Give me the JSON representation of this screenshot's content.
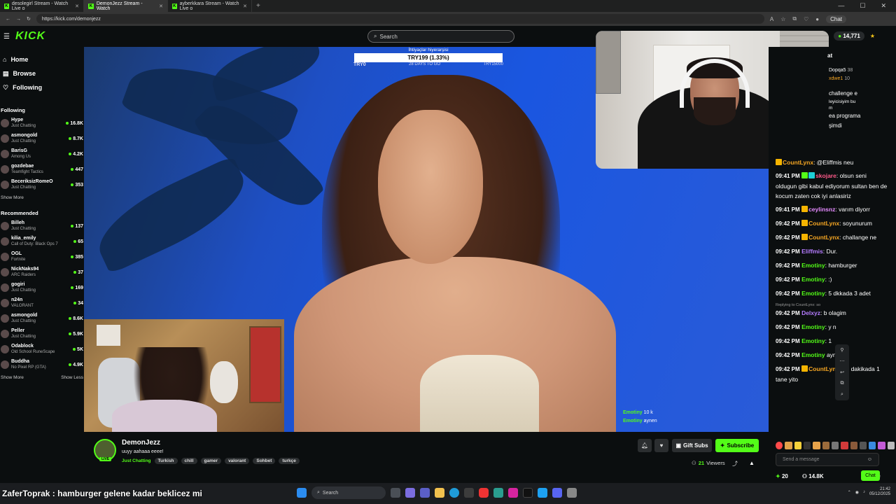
{
  "browser": {
    "tabs": [
      {
        "title": "desolegirl Stream - Watch Live o",
        "active": false
      },
      {
        "title": "DemonJezz Stream - Watch",
        "active": true
      },
      {
        "title": "ayberkkara Stream - Watch Live o",
        "active": false
      }
    ],
    "url": "https://kick.com/demonjezz",
    "chat_button": "Chat"
  },
  "header": {
    "logo": "KICK",
    "search_placeholder": "Search",
    "balance": "14,771"
  },
  "sidebar": {
    "nav": [
      {
        "label": "Home",
        "icon": "home-icon"
      },
      {
        "label": "Browse",
        "icon": "browse-icon"
      },
      {
        "label": "Following",
        "icon": "heart-icon"
      }
    ],
    "following_title": "Following",
    "following": [
      {
        "name": "Hype",
        "game": "Just Chatting",
        "viewers": "16.8K"
      },
      {
        "name": "asmongold",
        "game": "Just Chatting",
        "viewers": "8.7K"
      },
      {
        "name": "BarisG",
        "game": "Among Us",
        "viewers": "4.2K"
      },
      {
        "name": "gozdebae",
        "game": "Teamfight Tactics",
        "viewers": "447"
      },
      {
        "name": "BeceriksizRomeO",
        "game": "Just Chatting",
        "viewers": "353"
      }
    ],
    "show_more_1": "Show More",
    "recommended_title": "Recommended",
    "recommended": [
      {
        "name": "Billeh",
        "game": "Just Chatting",
        "viewers": "137"
      },
      {
        "name": "kilia_emily",
        "game": "Call of Duty: Black Ops 7",
        "viewers": "65"
      },
      {
        "name": "OGL",
        "game": "Fortnite",
        "viewers": "385"
      },
      {
        "name": "NickNaks94",
        "game": "ARC Raiders",
        "viewers": "37"
      },
      {
        "name": "gogiri",
        "game": "Just Chatting",
        "viewers": "169"
      },
      {
        "name": "n24n",
        "game": "VALORANT",
        "viewers": "34"
      },
      {
        "name": "asmongold",
        "game": "Just Chatting",
        "viewers": "8.6K"
      },
      {
        "name": "Peller",
        "game": "Just Chatting",
        "viewers": "5.9K"
      },
      {
        "name": "Odablock",
        "game": "Old School RuneScape",
        "viewers": "5K"
      },
      {
        "name": "Buddha",
        "game": "No Pixel RP (GTA)",
        "viewers": "4.9K"
      }
    ],
    "show_more_2": "Show More",
    "show_less": "Show Less"
  },
  "goal": {
    "title": "İhtiyaçlar hiyerarşisi",
    "progress_text": "TRY199 (1.33%)",
    "progress": 0.0133,
    "start": "TRY0",
    "days": "28 DAYS TO GO",
    "target": "TRY15000"
  },
  "overlay_chat": [
    {
      "user": "Emotiny",
      "text": "10 k"
    },
    {
      "user": "Emotiny",
      "text": "aynen"
    }
  ],
  "chat": {
    "top_users": [
      {
        "name": "Dopqa5",
        "count": "38"
      },
      {
        "name": "xdwe1",
        "count": "10"
      }
    ],
    "partial_lines": [
      "challenge e",
      "leyicisiyim bu",
      "m",
      "ea programa",
      "şimdi"
    ],
    "header_cut": "at",
    "messages": [
      {
        "time": "",
        "user": "CountLynx",
        "badge": "crown",
        "color": "#f5a623",
        "text": ": @Eliffmis neu"
      },
      {
        "time": "09:41 PM",
        "user": "skojare",
        "badge": "green",
        "color": "#ff5a8a",
        "text": ": olsun seni oldugun gibi kabul ediyorum sultan ben de kocum zaten cok iyi anlasiriz"
      },
      {
        "time": "09:41 PM",
        "user": "ceylinsnz",
        "badge": "crown",
        "color": "#e58bff",
        "text": ": varım diyorr"
      },
      {
        "time": "09:42 PM",
        "user": "CountLynx",
        "badge": "crown",
        "color": "#f5a623",
        "text": ": soyunurum"
      },
      {
        "time": "09:42 PM",
        "user": "CountLynx",
        "badge": "crown",
        "color": "#f5a623",
        "text": ": challange ne"
      },
      {
        "time": "09:42 PM",
        "user": "Eliffmis",
        "badge": "",
        "color": "#b57cff",
        "text": ": Dur."
      },
      {
        "time": "09:42 PM",
        "user": "Emotiny",
        "badge": "",
        "color": "#53fc18",
        "text": ": hamburger"
      },
      {
        "time": "09:42 PM",
        "user": "Emotiny",
        "badge": "",
        "color": "#53fc18",
        "text": ": :)"
      },
      {
        "time": "09:42 PM",
        "user": "Emotiny",
        "badge": "",
        "color": "#53fc18",
        "text": ": 5 dkkada 3 adet"
      },
      {
        "time": "09:42 PM",
        "user": "Delxyz",
        "badge": "",
        "color": "#b57cff",
        "text": ": b     olagim",
        "reply": "Replying to CountLynx: so"
      },
      {
        "time": "09:42 PM",
        "user": "Emotiny",
        "badge": "",
        "color": "#53fc18",
        "text": ": y      n"
      },
      {
        "time": "09:42 PM",
        "user": "Emotiny",
        "badge": "",
        "color": "#53fc18",
        "text": ": 1"
      },
      {
        "time": "09:42 PM",
        "user": "Emotiny",
        "badge": "",
        "color": "#53fc18",
        "text": " aynen"
      },
      {
        "time": "09:42 PM",
        "user": "CountLynx",
        "badge": "crown",
        "color": "#f5a623",
        "text": ": 20 dakikada 1 tane yito"
      }
    ],
    "send_placeholder": "Send a message",
    "points": "20",
    "followers": "14.8K",
    "chat_button": "Chat"
  },
  "stream": {
    "name": "DemonJezz",
    "title": "uuyy aahaaa eeee!",
    "category": "Just Chatting",
    "tags": [
      "Turkish",
      "chill",
      "gamer",
      "valorant",
      "Sohbet",
      "turkçe"
    ],
    "live_label": "LIVE",
    "gift_label": "Gift Subs",
    "subscribe_label": "Subscribe",
    "viewers": "21",
    "viewers_label": "Viewers"
  },
  "ticker": "ZaferToprak : hamburger gelene kadar beklicez mi",
  "taskbar": {
    "search": "Search",
    "time": "21:42",
    "date": "05/12/2025"
  }
}
